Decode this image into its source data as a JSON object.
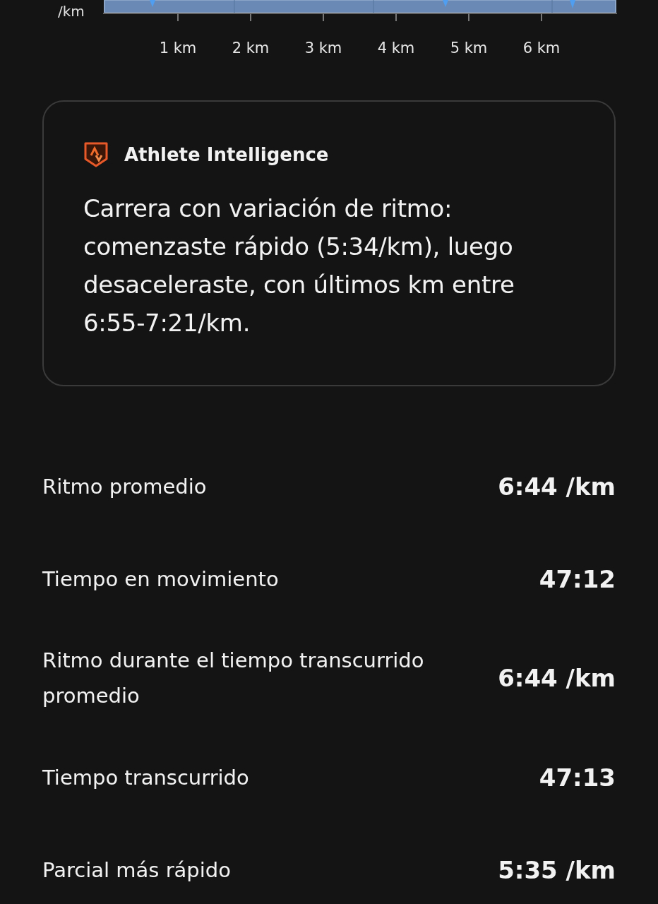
{
  "chart": {
    "y_unit": "/km",
    "x_labels": [
      "1 km",
      "2 km",
      "3 km",
      "4 km",
      "5 km",
      "6 km"
    ]
  },
  "insight": {
    "title": "Athlete Intelligence",
    "text": "Carrera con variación de ritmo: comenzaste rápido (5:34/km), luego desaceleraste, con últimos km entre 6:55-7:21/km."
  },
  "stats": [
    {
      "label": "Ritmo promedio",
      "value": "6:44 /km"
    },
    {
      "label": "Tiempo en movimiento",
      "value": "47:12"
    },
    {
      "label": "Ritmo durante el tiempo transcurrido promedio",
      "value": "6:44 /km"
    },
    {
      "label": "Tiempo transcurrido",
      "value": "47:13"
    },
    {
      "label": "Parcial más rápido",
      "value": "5:35 /km"
    }
  ]
}
